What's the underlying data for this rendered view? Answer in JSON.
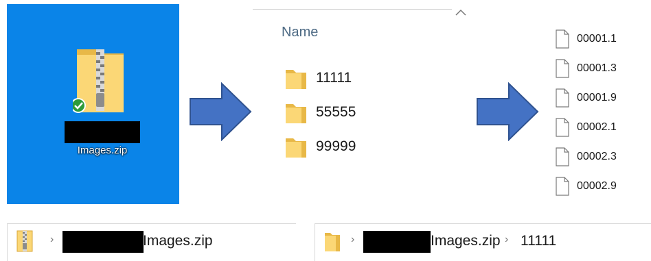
{
  "desktop": {
    "icon": "zip-folder-icon",
    "sync_badge": "green-check-badge",
    "label": "Images.zip",
    "background": "#0a84e8"
  },
  "folder_view": {
    "column_header": "Name",
    "folders": [
      "11111",
      "55555",
      "99999"
    ]
  },
  "file_view": {
    "files": [
      "00001.1",
      "00001.3",
      "00001.9",
      "00002.1",
      "00002.3",
      "00002.9"
    ]
  },
  "address_bar_1": {
    "icon": "zip-folder-icon",
    "separator": "›",
    "crumbs": [
      "Images.zip"
    ]
  },
  "address_bar_2": {
    "icon": "folder-icon",
    "separator": "›",
    "crumbs": [
      "Images.zip",
      "11111"
    ]
  },
  "colors": {
    "arrow_fill": "#4472c4",
    "arrow_stroke": "#2f528f",
    "folder_yellow": "#f8d775"
  }
}
